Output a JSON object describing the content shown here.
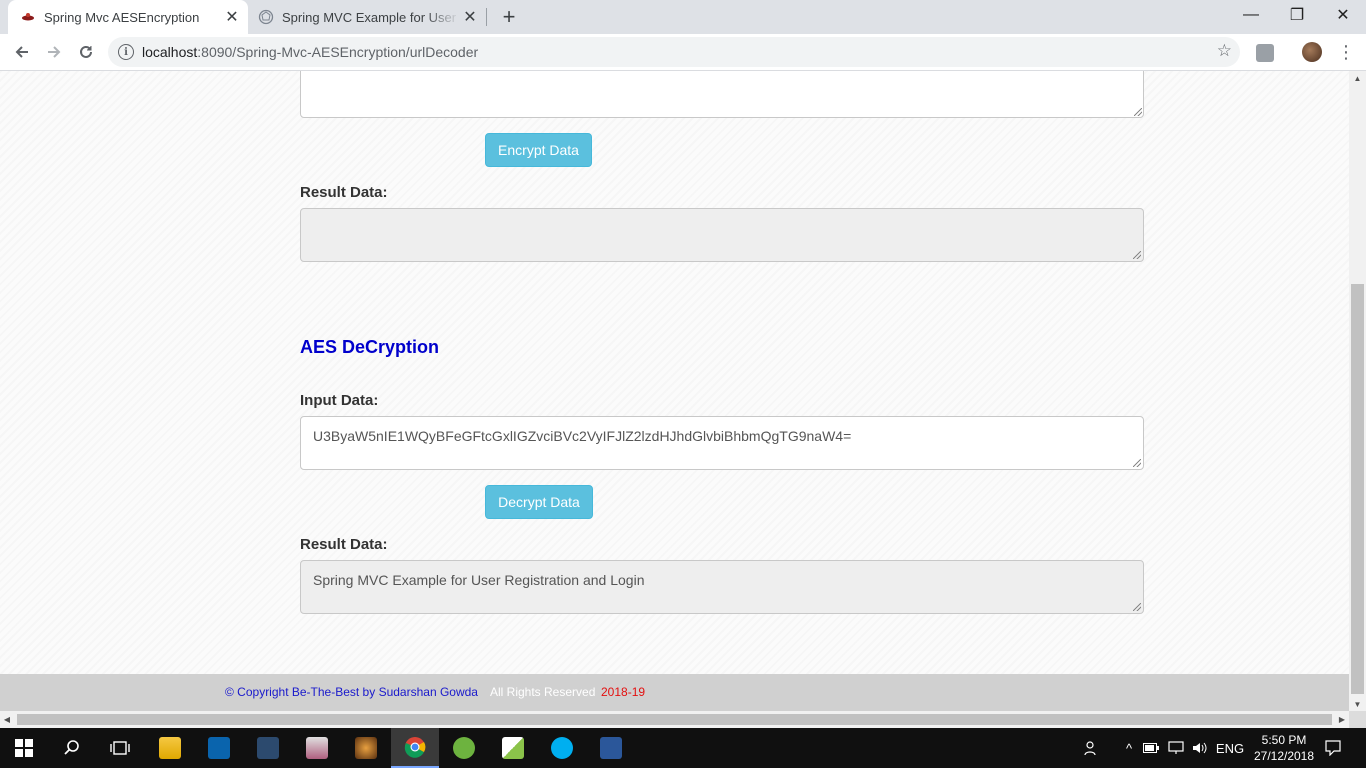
{
  "browser": {
    "tabs": [
      {
        "title": "Spring Mvc AESEncryption",
        "active": true
      },
      {
        "title": "Spring MVC Example for User Registration and Login",
        "active": false
      }
    ],
    "new_tab": "+",
    "url_host": "localhost",
    "url_rest": ":8090/Spring-Mvc-AESEncryption/urlDecoder",
    "window_controls": {
      "minimize": "—",
      "restore": "❐",
      "close": "✕"
    }
  },
  "page": {
    "encrypt_input_value": "",
    "encrypt_button": "Encrypt Data",
    "encrypt_result_label": "Result Data:",
    "encrypt_result_value": "",
    "decryption_title": "AES DeCryption",
    "decrypt_input_label": "Input Data:",
    "decrypt_input_value": "U3ByaW5nIE1WQyBFeGFtcGxlIGZvciBVc2VyIFJlZ2lzdHJhdGlvbiBhbmQgTG9naW4=",
    "decrypt_button": "Decrypt Data",
    "decrypt_result_label": "Result Data:",
    "decrypt_result_value": "Spring MVC Example for User Registration and Login"
  },
  "footer": {
    "copyright": "© Copyright Be-The-Best by Sudarshan Gowda",
    "rights": "All Rights Reserved",
    "years": "2018-19"
  },
  "taskbar": {
    "apps": [
      "file-explorer",
      "outlook",
      "mysql-workbench",
      "database-tool",
      "media-app",
      "chrome",
      "spring-tool-suite",
      "notepad-plus-plus",
      "skype",
      "word"
    ],
    "language": "ENG",
    "time": "5:50 PM",
    "date": "27/12/2018"
  },
  "colors": {
    "info_button": "#5bc0de",
    "section_title": "#0000cc",
    "footer_copyright": "#1a1acc",
    "footer_years": "#e31010"
  }
}
